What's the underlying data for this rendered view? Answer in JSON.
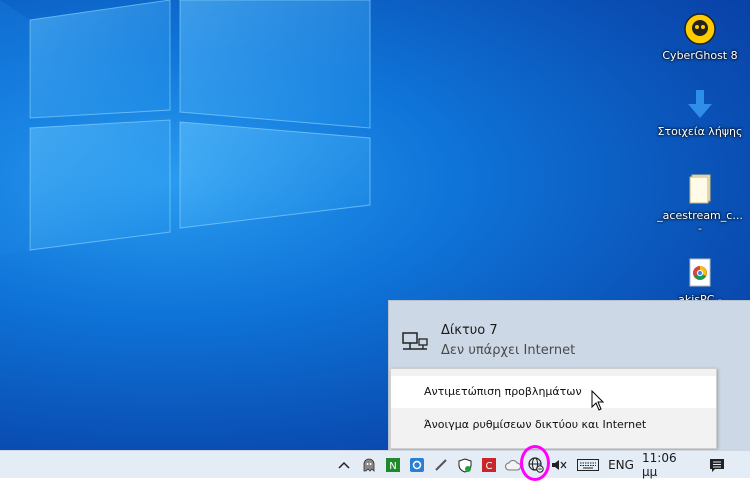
{
  "desktop": {
    "icons": [
      {
        "label": "CyberGhost 8"
      },
      {
        "label": "Στοιχεία λήψης"
      },
      {
        "label": "_acestream_c...\n-"
      },
      {
        "label": "akisPC -"
      }
    ]
  },
  "network_flyout": {
    "network_name": "Δίκτυο 7",
    "network_status": "Δεν υπάρχει Internet"
  },
  "context_menu": {
    "items": [
      {
        "label": "Αντιμετώπιση προβλημάτων"
      },
      {
        "label": "Άνοιγμα ρυθμίσεων δικτύου και Internet"
      }
    ]
  },
  "taskbar": {
    "language": "ENG",
    "time": "11:06 μμ"
  },
  "colors": {
    "highlight_ring": "#ff00ff",
    "taskbar_bg": "#e4ecf6",
    "flyout_bg": "#cdd8e6"
  }
}
